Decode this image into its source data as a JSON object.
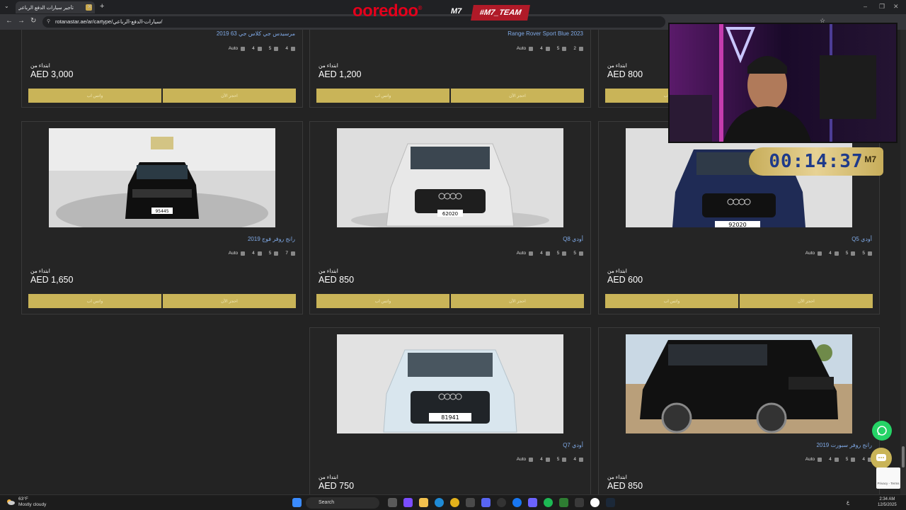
{
  "browser": {
    "tab_title": "تأجير سيارات الدفع الرباعي في د..",
    "url_site": "rotanastar.ae",
    "url_path": "/ar/cartype/سيارات-الدفع-الرباعي/",
    "new_tab": "+",
    "tab_close": "✕"
  },
  "overlay": {
    "sponsor": "ooredoo",
    "team_mark": "M7",
    "team_tag": "#M7_TEAM",
    "timer": "00:14:37",
    "timer_mark": "M7"
  },
  "labels": {
    "from": "ابتداء من",
    "whatsapp_btn": "واتس اب",
    "book_btn": "احجز الآن",
    "transmission": "Auto"
  },
  "cars": [
    {
      "name": "مرسيدس جي كلاس جي 63 2019",
      "doors": "4",
      "bags": "5",
      "seats": "4",
      "price": "AED 3,000"
    },
    {
      "name": "Range Rover Sport Blue 2023",
      "doors": "4",
      "bags": "5",
      "seats": "2",
      "price": "AED 1,200"
    },
    {
      "name": "",
      "doors": "",
      "bags": "",
      "seats": "",
      "price": "AED 800"
    },
    {
      "name": "رانج روفر فوج 2019",
      "doors": "4",
      "bags": "5",
      "seats": "7",
      "price": "AED 1,650"
    },
    {
      "name": "أودي Q8",
      "doors": "4",
      "bags": "5",
      "seats": "5",
      "price": "AED 850"
    },
    {
      "name": "أودي Q5",
      "doors": "4",
      "bags": "5",
      "seats": "5",
      "price": "AED 600"
    },
    {
      "name": "أودي Q7",
      "doors": "4",
      "bags": "5",
      "seats": "4",
      "price": "AED 750"
    },
    {
      "name": "رانج روفر سبورت 2019",
      "doors": "4",
      "bags": "5",
      "seats": "4",
      "price": "AED 850"
    }
  ],
  "plates": [
    "95445",
    "62020",
    "92020",
    "81941"
  ],
  "recaptcha": "Privacy - Terms",
  "taskbar": {
    "temp": "63°F",
    "weather": "Mostly cloudy",
    "search": "Search",
    "time": "2:34 AM",
    "date": "12/5/2025",
    "lang": "ع"
  }
}
